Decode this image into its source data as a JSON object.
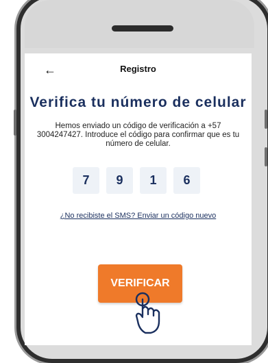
{
  "header": {
    "back_icon": "arrow-left-icon",
    "title": "Registro"
  },
  "main": {
    "heading": "Verifica tu número de celular",
    "description": "Hemos enviado un código de verificación a +57 3004247427. Introduce el código para confirmar que es tu número de celular.",
    "code_digits": [
      "7",
      "9",
      "1",
      "6"
    ],
    "resend_link": "¿No recibiste el SMS? Enviar un código nuevo",
    "verify_button": "VERIFICAR"
  },
  "colors": {
    "primary": "#1a2f5e",
    "accent": "#ef7a2a",
    "code_bg": "#eef2f7"
  }
}
